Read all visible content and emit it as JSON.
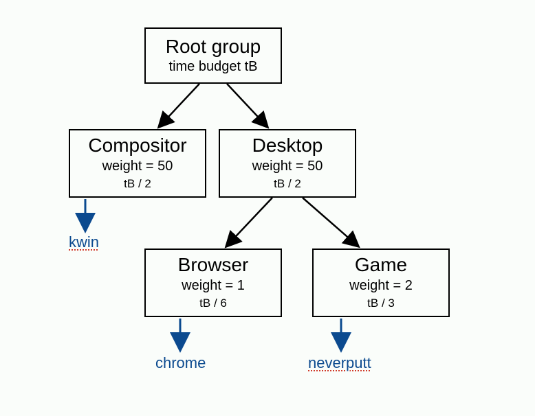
{
  "root": {
    "title": "Root group",
    "sub1": "time budget tB",
    "sub2": ""
  },
  "compositor": {
    "title": "Compositor",
    "sub1": "weight = 50",
    "sub2": "tB / 2"
  },
  "desktop": {
    "title": "Desktop",
    "sub1": "weight = 50",
    "sub2": "tB / 2"
  },
  "browser": {
    "title": "Browser",
    "sub1": "weight = 1",
    "sub2": "tB / 6"
  },
  "game": {
    "title": "Game",
    "sub1": "weight = 2",
    "sub2": "tB / 3"
  },
  "leaf_kwin": "kwin",
  "leaf_chrome": "chrome",
  "leaf_neverputt": "neverputt"
}
